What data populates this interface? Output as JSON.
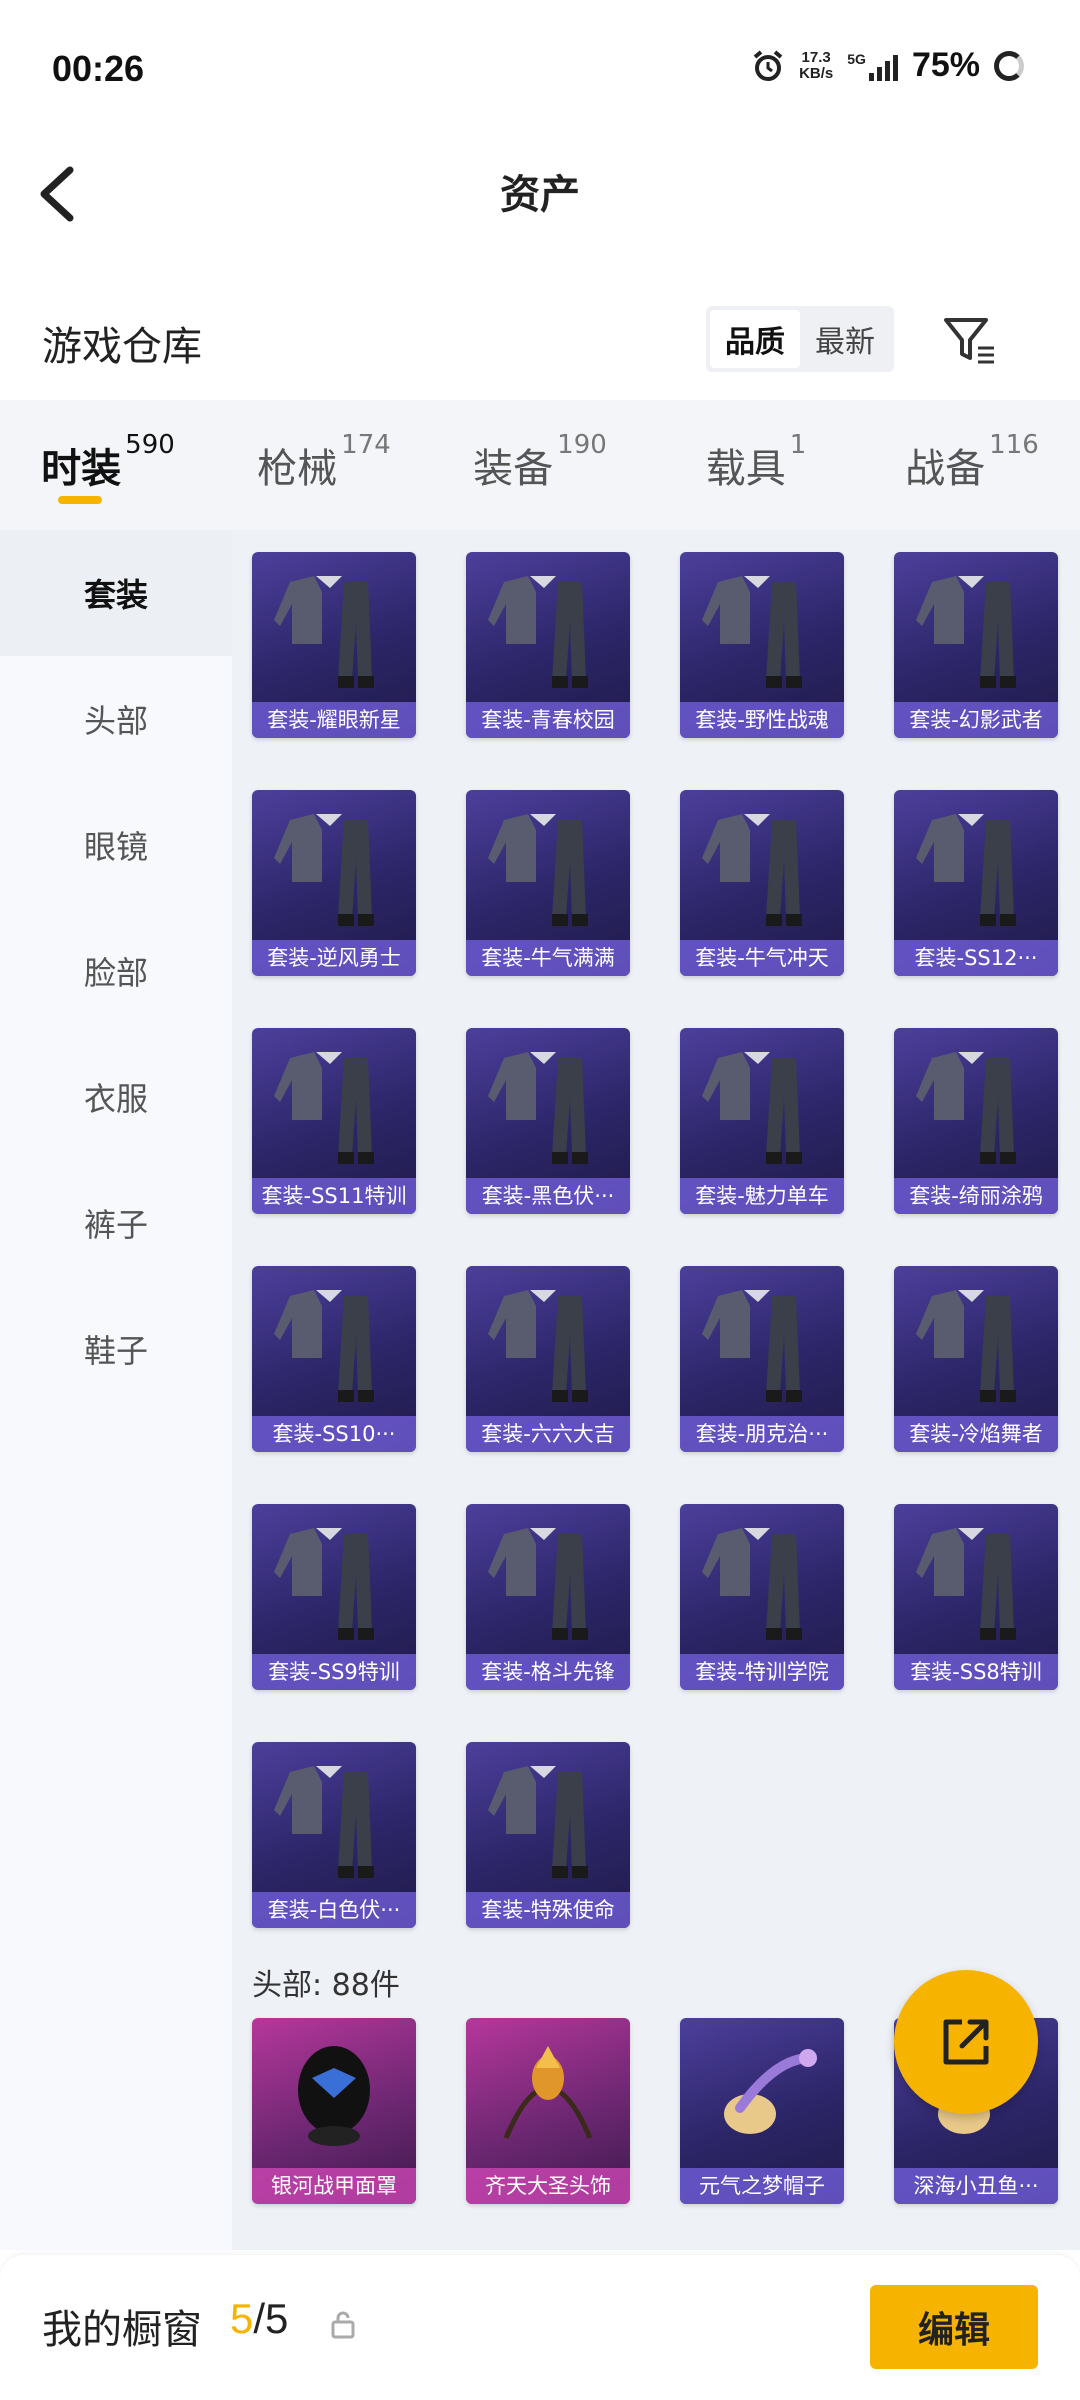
{
  "status_bar": {
    "time": "00:26",
    "net_speed": "17.3",
    "net_unit": "KB/s",
    "network": "5G",
    "battery": "75%"
  },
  "header": {
    "title": "资产"
  },
  "section": {
    "title": "游戏仓库",
    "sort_options": [
      "品质",
      "最新"
    ],
    "sort_active": "品质"
  },
  "tabs": [
    {
      "label": "时装",
      "count": "590",
      "active": true
    },
    {
      "label": "枪械",
      "count": "174",
      "active": false
    },
    {
      "label": "装备",
      "count": "190",
      "active": false
    },
    {
      "label": "载具",
      "count": "1",
      "active": false
    },
    {
      "label": "战备",
      "count": "116",
      "active": false
    }
  ],
  "sidebar": {
    "items": [
      {
        "label": "套装",
        "active": true
      },
      {
        "label": "头部",
        "active": false
      },
      {
        "label": "眼镜",
        "active": false
      },
      {
        "label": "脸部",
        "active": false
      },
      {
        "label": "衣服",
        "active": false
      },
      {
        "label": "裤子",
        "active": false
      },
      {
        "label": "鞋子",
        "active": false
      }
    ]
  },
  "suits": [
    {
      "label": "套装-耀眼新星",
      "icon": "outfit-icon"
    },
    {
      "label": "套装-青春校园",
      "icon": "outfit-icon"
    },
    {
      "label": "套装-野性战魂",
      "icon": "outfit-icon"
    },
    {
      "label": "套装-幻影武者",
      "icon": "outfit-icon"
    },
    {
      "label": "套装-逆风勇士",
      "icon": "outfit-icon"
    },
    {
      "label": "套装-牛气满满",
      "icon": "outfit-icon"
    },
    {
      "label": "套装-牛气冲天",
      "icon": "outfit-icon"
    },
    {
      "label": "套装-SS12···",
      "icon": "outfit-icon"
    },
    {
      "label": "套装-SS11特训",
      "icon": "outfit-icon"
    },
    {
      "label": "套装-黑色伏···",
      "icon": "outfit-icon"
    },
    {
      "label": "套装-魅力单车",
      "icon": "outfit-icon"
    },
    {
      "label": "套装-绮丽涂鸦",
      "icon": "outfit-icon"
    },
    {
      "label": "套装-SS10···",
      "icon": "outfit-icon"
    },
    {
      "label": "套装-六六大吉",
      "icon": "outfit-icon"
    },
    {
      "label": "套装-朋克治···",
      "icon": "outfit-icon"
    },
    {
      "label": "套装-冷焰舞者",
      "icon": "outfit-icon"
    },
    {
      "label": "套装-SS9特训",
      "icon": "outfit-icon"
    },
    {
      "label": "套装-格斗先锋",
      "icon": "outfit-icon"
    },
    {
      "label": "套装-特训学院",
      "icon": "outfit-icon"
    },
    {
      "label": "套装-SS8特训",
      "icon": "outfit-icon"
    },
    {
      "label": "套装-白色伏···",
      "icon": "outfit-icon"
    },
    {
      "label": "套装-特殊使命",
      "icon": "outfit-icon"
    }
  ],
  "head_section": {
    "heading": "头部: 88件",
    "items": [
      {
        "label": "银河战甲面罩",
        "rarity": "legendary",
        "icon": "mask-icon"
      },
      {
        "label": "齐天大圣头饰",
        "rarity": "legendary",
        "icon": "headband-icon"
      },
      {
        "label": "元气之梦帽子",
        "rarity": "epic",
        "icon": "hat-icon"
      },
      {
        "label": "深海小丑鱼···",
        "rarity": "epic",
        "icon": "hat-icon"
      }
    ]
  },
  "colors": {
    "accent": "#f6b400",
    "card_epic": "#2c2567",
    "card_legendary": "#8c2d86"
  },
  "bottom_bar": {
    "label": "我的橱窗",
    "count_current": "5",
    "count_sep": "/",
    "count_total": "5",
    "edit_label": "编辑"
  }
}
